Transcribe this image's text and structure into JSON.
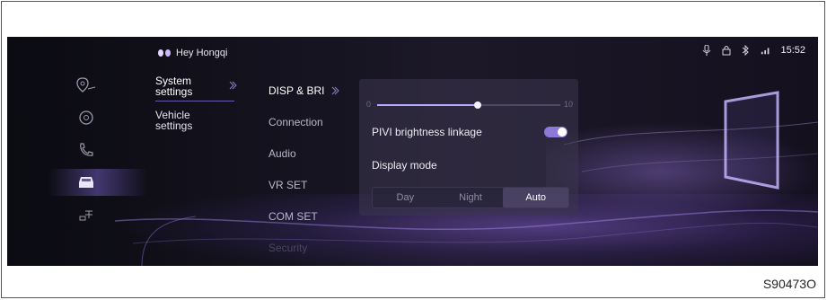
{
  "status_bar": {
    "voice_label": "Hey Hongqi",
    "time": "15:52",
    "icons": [
      "mic-icon",
      "lock-icon",
      "bluetooth-icon",
      "signal-icon"
    ]
  },
  "left_nav": {
    "icons": [
      "navigation-icon",
      "media-icon",
      "phone-icon",
      "car-icon",
      "charging-icon"
    ],
    "active_index": 3
  },
  "level1_menu": [
    {
      "label": "System settings",
      "active": true
    },
    {
      "label": "Vehicle settings",
      "active": false
    }
  ],
  "level2_menu": [
    {
      "label": "DISP & BRI",
      "active": true
    },
    {
      "label": "Connection",
      "active": false
    },
    {
      "label": "Audio",
      "active": false
    },
    {
      "label": "VR SET",
      "active": false
    },
    {
      "label": "COM SET",
      "active": false
    },
    {
      "label": "Security",
      "active": false
    }
  ],
  "brightness": {
    "min_label": "0",
    "max_label": "10",
    "value": 5.5
  },
  "pivi": {
    "label": "PIVI brightness linkage",
    "on": true
  },
  "display_mode": {
    "label": "Display mode",
    "options": [
      "Day",
      "Night",
      "Auto"
    ],
    "selected": "Auto"
  },
  "caption": "S90473O",
  "colors": {
    "accent": "#8e78d8",
    "background": "#15131f"
  }
}
